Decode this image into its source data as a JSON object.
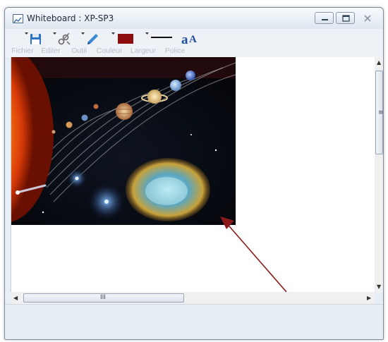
{
  "window": {
    "title": "Whiteboard : XP-SP3"
  },
  "toolbar": {
    "items": [
      {
        "label": "Fichier",
        "icon": "floppy-disk-icon"
      },
      {
        "label": "Editer",
        "icon": "edit-tools-icon"
      },
      {
        "label": "Outil",
        "icon": "pen-tool-icon"
      },
      {
        "label": "Couleur",
        "icon": "color-swatch-icon",
        "color": "#8b0d0d"
      },
      {
        "label": "Largeur",
        "icon": "line-width-icon"
      },
      {
        "label": "Police",
        "icon": "font-icon"
      }
    ]
  },
  "canvas": {
    "image": "solar-system-image",
    "arrow_color": "#8b1a1a"
  },
  "scrollbars": {
    "vertical_grip": "≡",
    "horizontal_grip": "III"
  }
}
